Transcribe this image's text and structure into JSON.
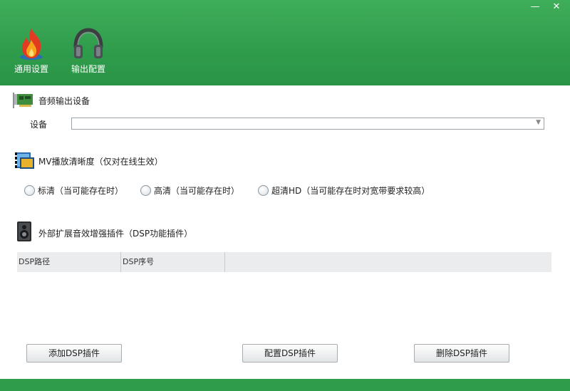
{
  "toolbar": {
    "general_label": "通用设置",
    "output_label": "输出配置"
  },
  "window": {
    "min_glyph": "—",
    "close_glyph": "✕"
  },
  "audio_output": {
    "title": "音频输出设备",
    "device_label": "设备",
    "device_value": ""
  },
  "mv_quality": {
    "title": "MV播放清晰度（仅对在线生效）",
    "options": [
      {
        "label": "标清（当可能存在时）",
        "selected": false
      },
      {
        "label": "高清（当可能存在时）",
        "selected": false
      },
      {
        "label": "超清HD（当可能存在时对宽带要求较高）",
        "selected": false
      }
    ]
  },
  "dsp": {
    "title": "外部扩展音效增强插件（DSP功能插件）",
    "columns": [
      "DSP路径",
      "DSP序号"
    ],
    "rows": [],
    "add_label": "添加DSP插件",
    "config_label": "配置DSP插件",
    "delete_label": "删除DSP插件"
  },
  "colors": {
    "accent": "#2f9c4c"
  }
}
